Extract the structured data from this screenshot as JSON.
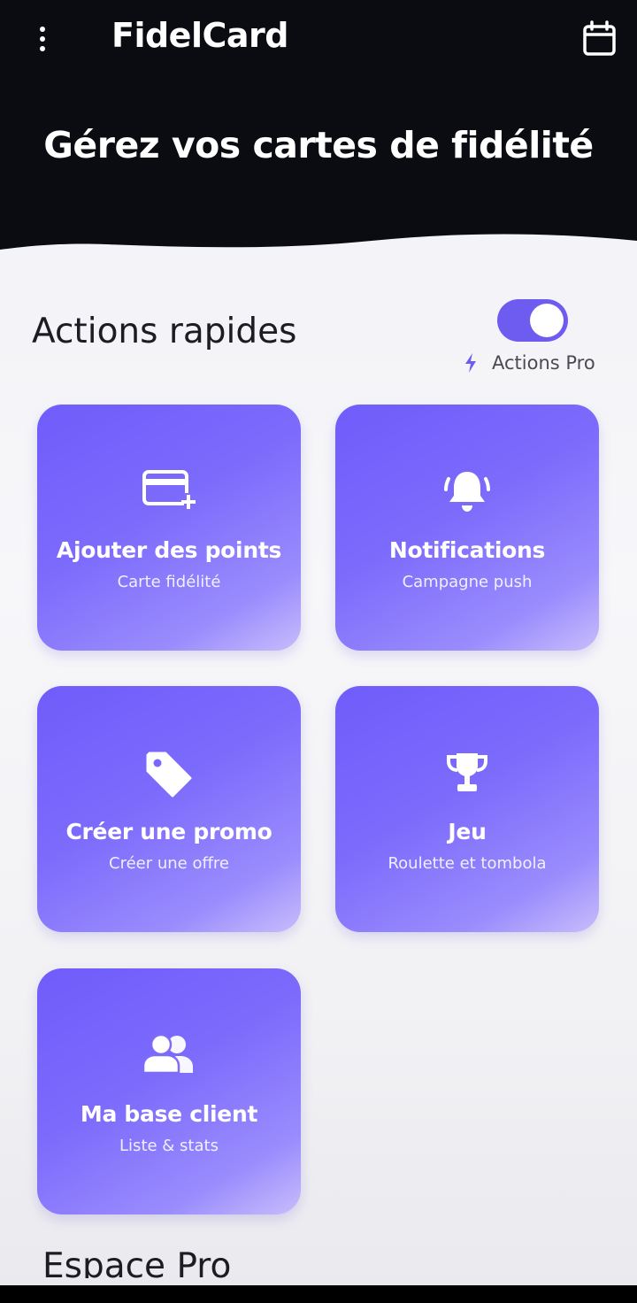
{
  "app": {
    "title": "FidelCard",
    "menu_icon": "more-vertical-icon",
    "calendar_icon": "calendar-icon"
  },
  "hero": {
    "title": "Gérez vos cartes de fidélité"
  },
  "quick_actions": {
    "title": "Actions rapides",
    "pro_toggle": {
      "label": "Actions Pro",
      "enabled": true,
      "icon": "lightning-icon"
    },
    "tiles": [
      {
        "title": "Ajouter des points",
        "subtitle": "Carte fidélité",
        "icon": "add-card-icon"
      },
      {
        "title": "Notifications",
        "subtitle": "Campagne push",
        "icon": "bell-icon"
      },
      {
        "title": "Créer une promo",
        "subtitle": "Créer une offre",
        "icon": "tag-icon"
      },
      {
        "title": "Jeu",
        "subtitle": "Roulette et tombola",
        "icon": "trophy-icon"
      },
      {
        "title": "Ma base client",
        "subtitle": "Liste & stats",
        "icon": "users-icon"
      }
    ]
  },
  "next_section": {
    "title": "Espace Pro"
  },
  "colors": {
    "header_bg": "#0a0c12",
    "accent": "#6e5cf0",
    "tile_start": "#6f5cfb",
    "tile_end": "#c8bdfb",
    "page_bg": "#f3f3f7"
  }
}
